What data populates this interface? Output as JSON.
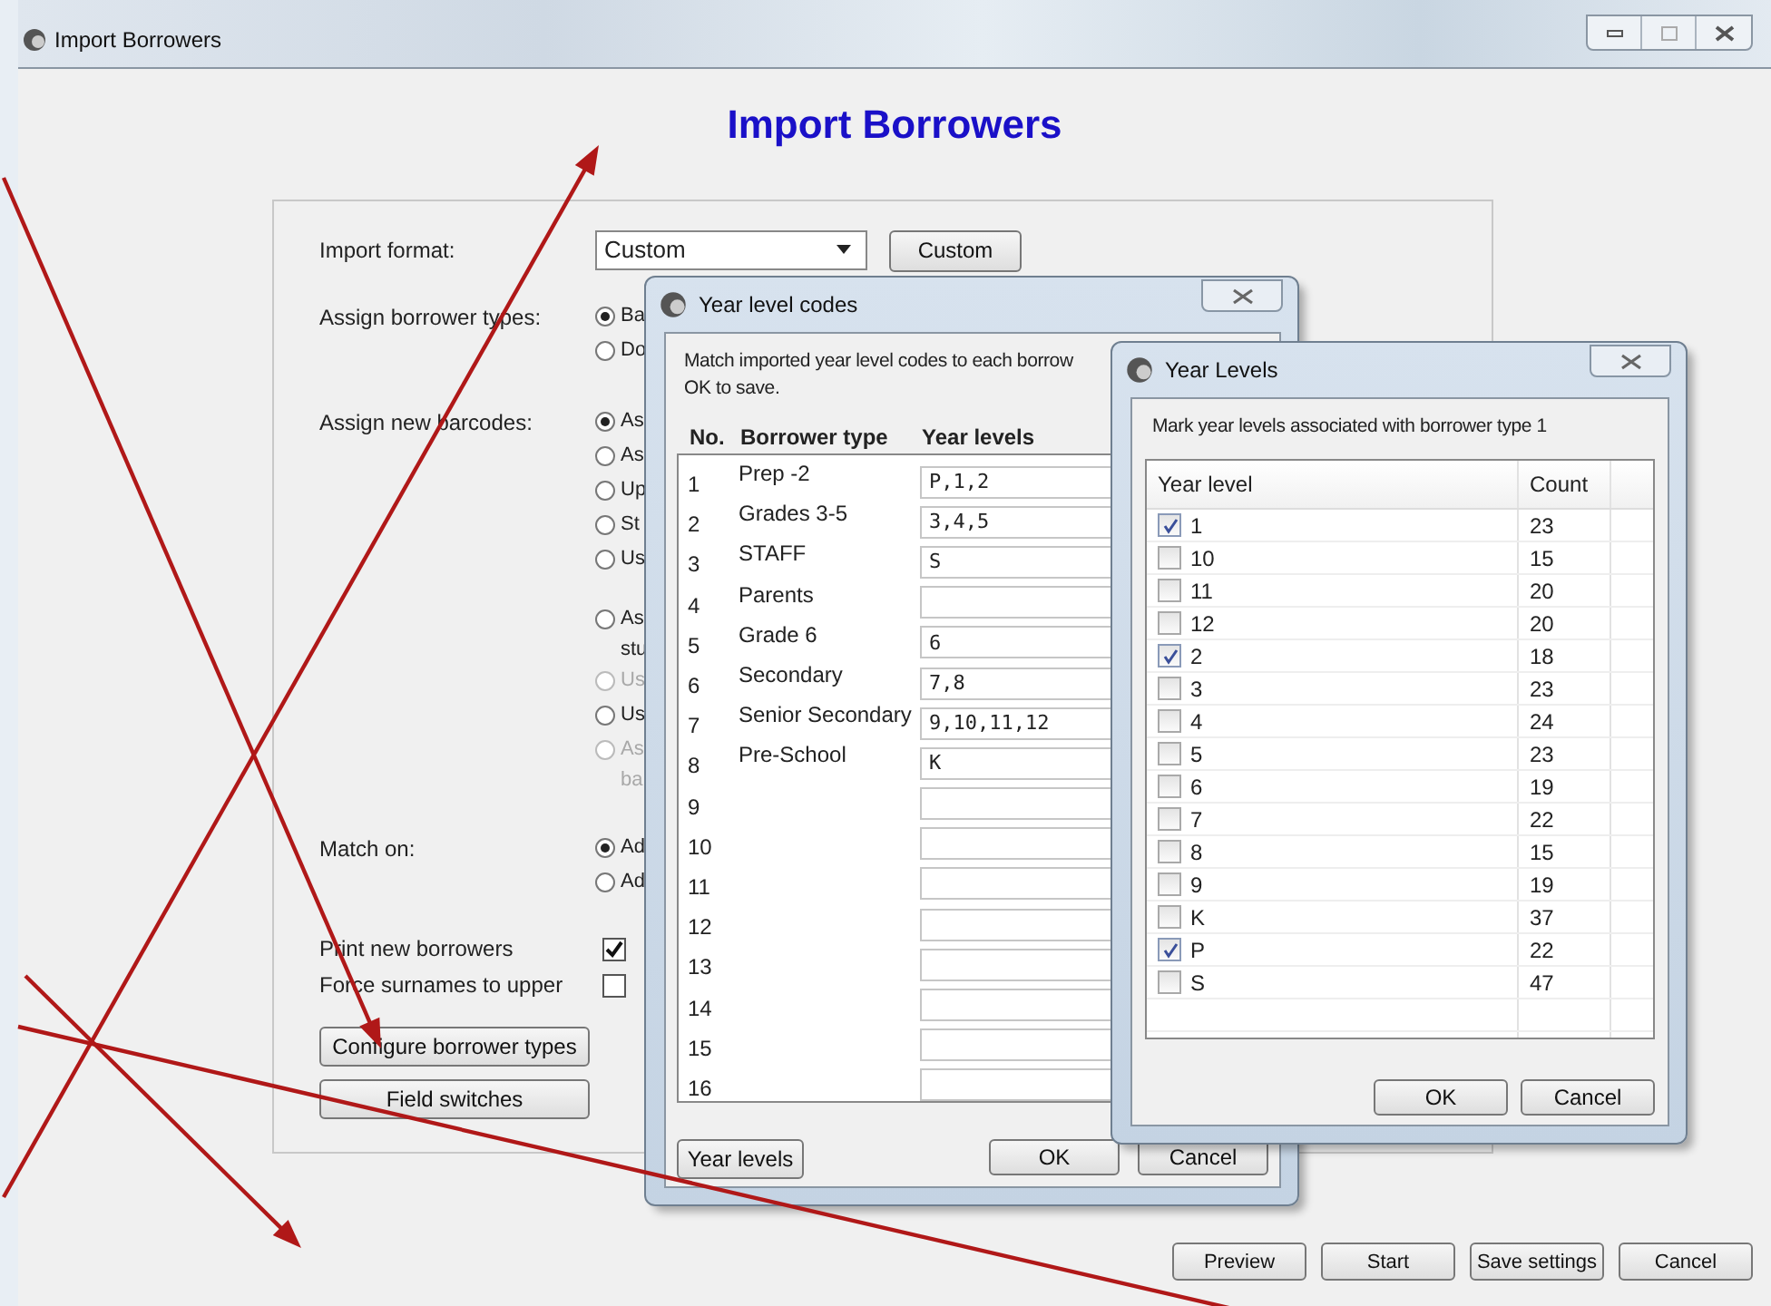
{
  "window": {
    "title": "Import Borrowers",
    "heading": "Import Borrowers"
  },
  "form": {
    "import_format": {
      "label": "Import format:",
      "value": "Custom",
      "button": "Custom"
    },
    "groups": [
      {
        "label": "Assign borrower types:",
        "option_sets": [
          [
            {
              "lines": [
                "Ba"
              ],
              "selected": true,
              "disabled": false
            },
            {
              "lines": [
                "Do"
              ],
              "selected": false,
              "disabled": false
            }
          ]
        ]
      },
      {
        "label": "Assign new barcodes:",
        "option_sets": [
          [
            {
              "lines": [
                "As"
              ],
              "selected": true,
              "disabled": false
            },
            {
              "lines": [
                "As"
              ],
              "selected": false,
              "disabled": false
            },
            {
              "lines": [
                "Up"
              ],
              "selected": false,
              "disabled": false
            },
            {
              "lines": [
                "St"
              ],
              "selected": false,
              "disabled": false
            },
            {
              "lines": [
                "Us"
              ],
              "selected": false,
              "disabled": false
            }
          ],
          [
            {
              "lines": [
                "As",
                "stu"
              ],
              "selected": false,
              "disabled": false
            },
            {
              "lines": [
                "Us"
              ],
              "selected": false,
              "disabled": true
            },
            {
              "lines": [
                "Us"
              ],
              "selected": false,
              "disabled": false
            },
            {
              "lines": [
                "As",
                "ba"
              ],
              "selected": false,
              "disabled": true
            }
          ]
        ]
      },
      {
        "label": "Match on:",
        "option_sets": [
          [
            {
              "lines": [
                "Ad"
              ],
              "selected": true,
              "disabled": false
            },
            {
              "lines": [
                "Ad"
              ],
              "selected": false,
              "disabled": false
            }
          ]
        ]
      }
    ],
    "checks": [
      {
        "label": "Print new borrowers",
        "checked": true
      },
      {
        "label": "Force surnames to upper",
        "checked": false
      }
    ],
    "buttons": [
      "Configure borrower types",
      "Field switches"
    ]
  },
  "footer_buttons": [
    "Preview",
    "Start",
    "Save settings",
    "Cancel"
  ],
  "year_level_codes": {
    "title": "Year level codes",
    "instructions": [
      "Match imported year level codes to each borrow",
      "OK to save."
    ],
    "columns": [
      "No.",
      "Borrower type",
      "Year levels"
    ],
    "rows": [
      {
        "no": "1",
        "type": "Prep -2",
        "levels": "P,1,2"
      },
      {
        "no": "2",
        "type": "Grades 3-5",
        "levels": "3,4,5"
      },
      {
        "no": "3",
        "type": "STAFF",
        "levels": "S"
      },
      {
        "no": "4",
        "type": "Parents",
        "levels": ""
      },
      {
        "no": "5",
        "type": "Grade 6",
        "levels": "6"
      },
      {
        "no": "6",
        "type": "Secondary",
        "levels": "7,8"
      },
      {
        "no": "7",
        "type": "Senior Secondary",
        "levels": "9,10,11,12"
      },
      {
        "no": "8",
        "type": "Pre-School",
        "levels": "K"
      },
      {
        "no": "9",
        "type": "",
        "levels": ""
      },
      {
        "no": "10",
        "type": "",
        "levels": ""
      },
      {
        "no": "11",
        "type": "",
        "levels": ""
      },
      {
        "no": "12",
        "type": "",
        "levels": ""
      },
      {
        "no": "13",
        "type": "",
        "levels": ""
      },
      {
        "no": "14",
        "type": "",
        "levels": ""
      },
      {
        "no": "15",
        "type": "",
        "levels": ""
      },
      {
        "no": "16",
        "type": "",
        "levels": ""
      }
    ],
    "buttons": [
      "Year levels",
      "OK",
      "Cancel"
    ]
  },
  "year_levels": {
    "title": "Year Levels",
    "instructions": "Mark year levels associated with borrower type 1",
    "columns": [
      "Year level",
      "Count"
    ],
    "rows": [
      {
        "level": "1",
        "count": "23",
        "checked": true
      },
      {
        "level": "10",
        "count": "15",
        "checked": false
      },
      {
        "level": "11",
        "count": "20",
        "checked": false
      },
      {
        "level": "12",
        "count": "20",
        "checked": false
      },
      {
        "level": "2",
        "count": "18",
        "checked": true
      },
      {
        "level": "3",
        "count": "23",
        "checked": false
      },
      {
        "level": "4",
        "count": "24",
        "checked": false
      },
      {
        "level": "5",
        "count": "23",
        "checked": false
      },
      {
        "level": "6",
        "count": "19",
        "checked": false
      },
      {
        "level": "7",
        "count": "22",
        "checked": false
      },
      {
        "level": "8",
        "count": "15",
        "checked": false
      },
      {
        "level": "9",
        "count": "19",
        "checked": false
      },
      {
        "level": "K",
        "count": "37",
        "checked": false
      },
      {
        "level": "P",
        "count": "22",
        "checked": true
      },
      {
        "level": "S",
        "count": "47",
        "checked": false
      }
    ],
    "buttons": [
      "OK",
      "Cancel"
    ]
  }
}
